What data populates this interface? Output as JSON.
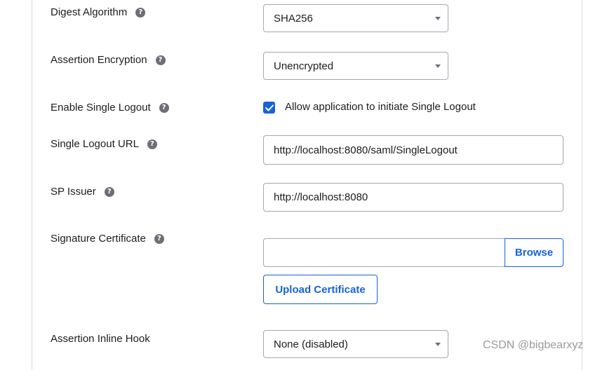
{
  "fields": {
    "digest_algorithm": {
      "label": "Digest Algorithm",
      "value": "SHA256"
    },
    "assertion_encryption": {
      "label": "Assertion Encryption",
      "value": "Unencrypted"
    },
    "enable_single_logout": {
      "label": "Enable Single Logout",
      "checkbox_label": "Allow application to initiate Single Logout",
      "checked": true
    },
    "single_logout_url": {
      "label": "Single Logout URL",
      "value": "http://localhost:8080/saml/SingleLogout"
    },
    "sp_issuer": {
      "label": "SP Issuer",
      "value": "http://localhost:8080"
    },
    "signature_certificate": {
      "label": "Signature Certificate",
      "file_value": "",
      "browse_label": "Browse",
      "upload_label": "Upload Certificate"
    },
    "assertion_inline_hook": {
      "label": "Assertion Inline Hook",
      "value": "None (disabled)"
    }
  },
  "help_icon_glyph": "?",
  "watermark": "CSDN @bigbearxyz",
  "colors": {
    "accent": "#1662dd",
    "help_icon": "#6e6e78",
    "border": "#a7a7b0"
  }
}
